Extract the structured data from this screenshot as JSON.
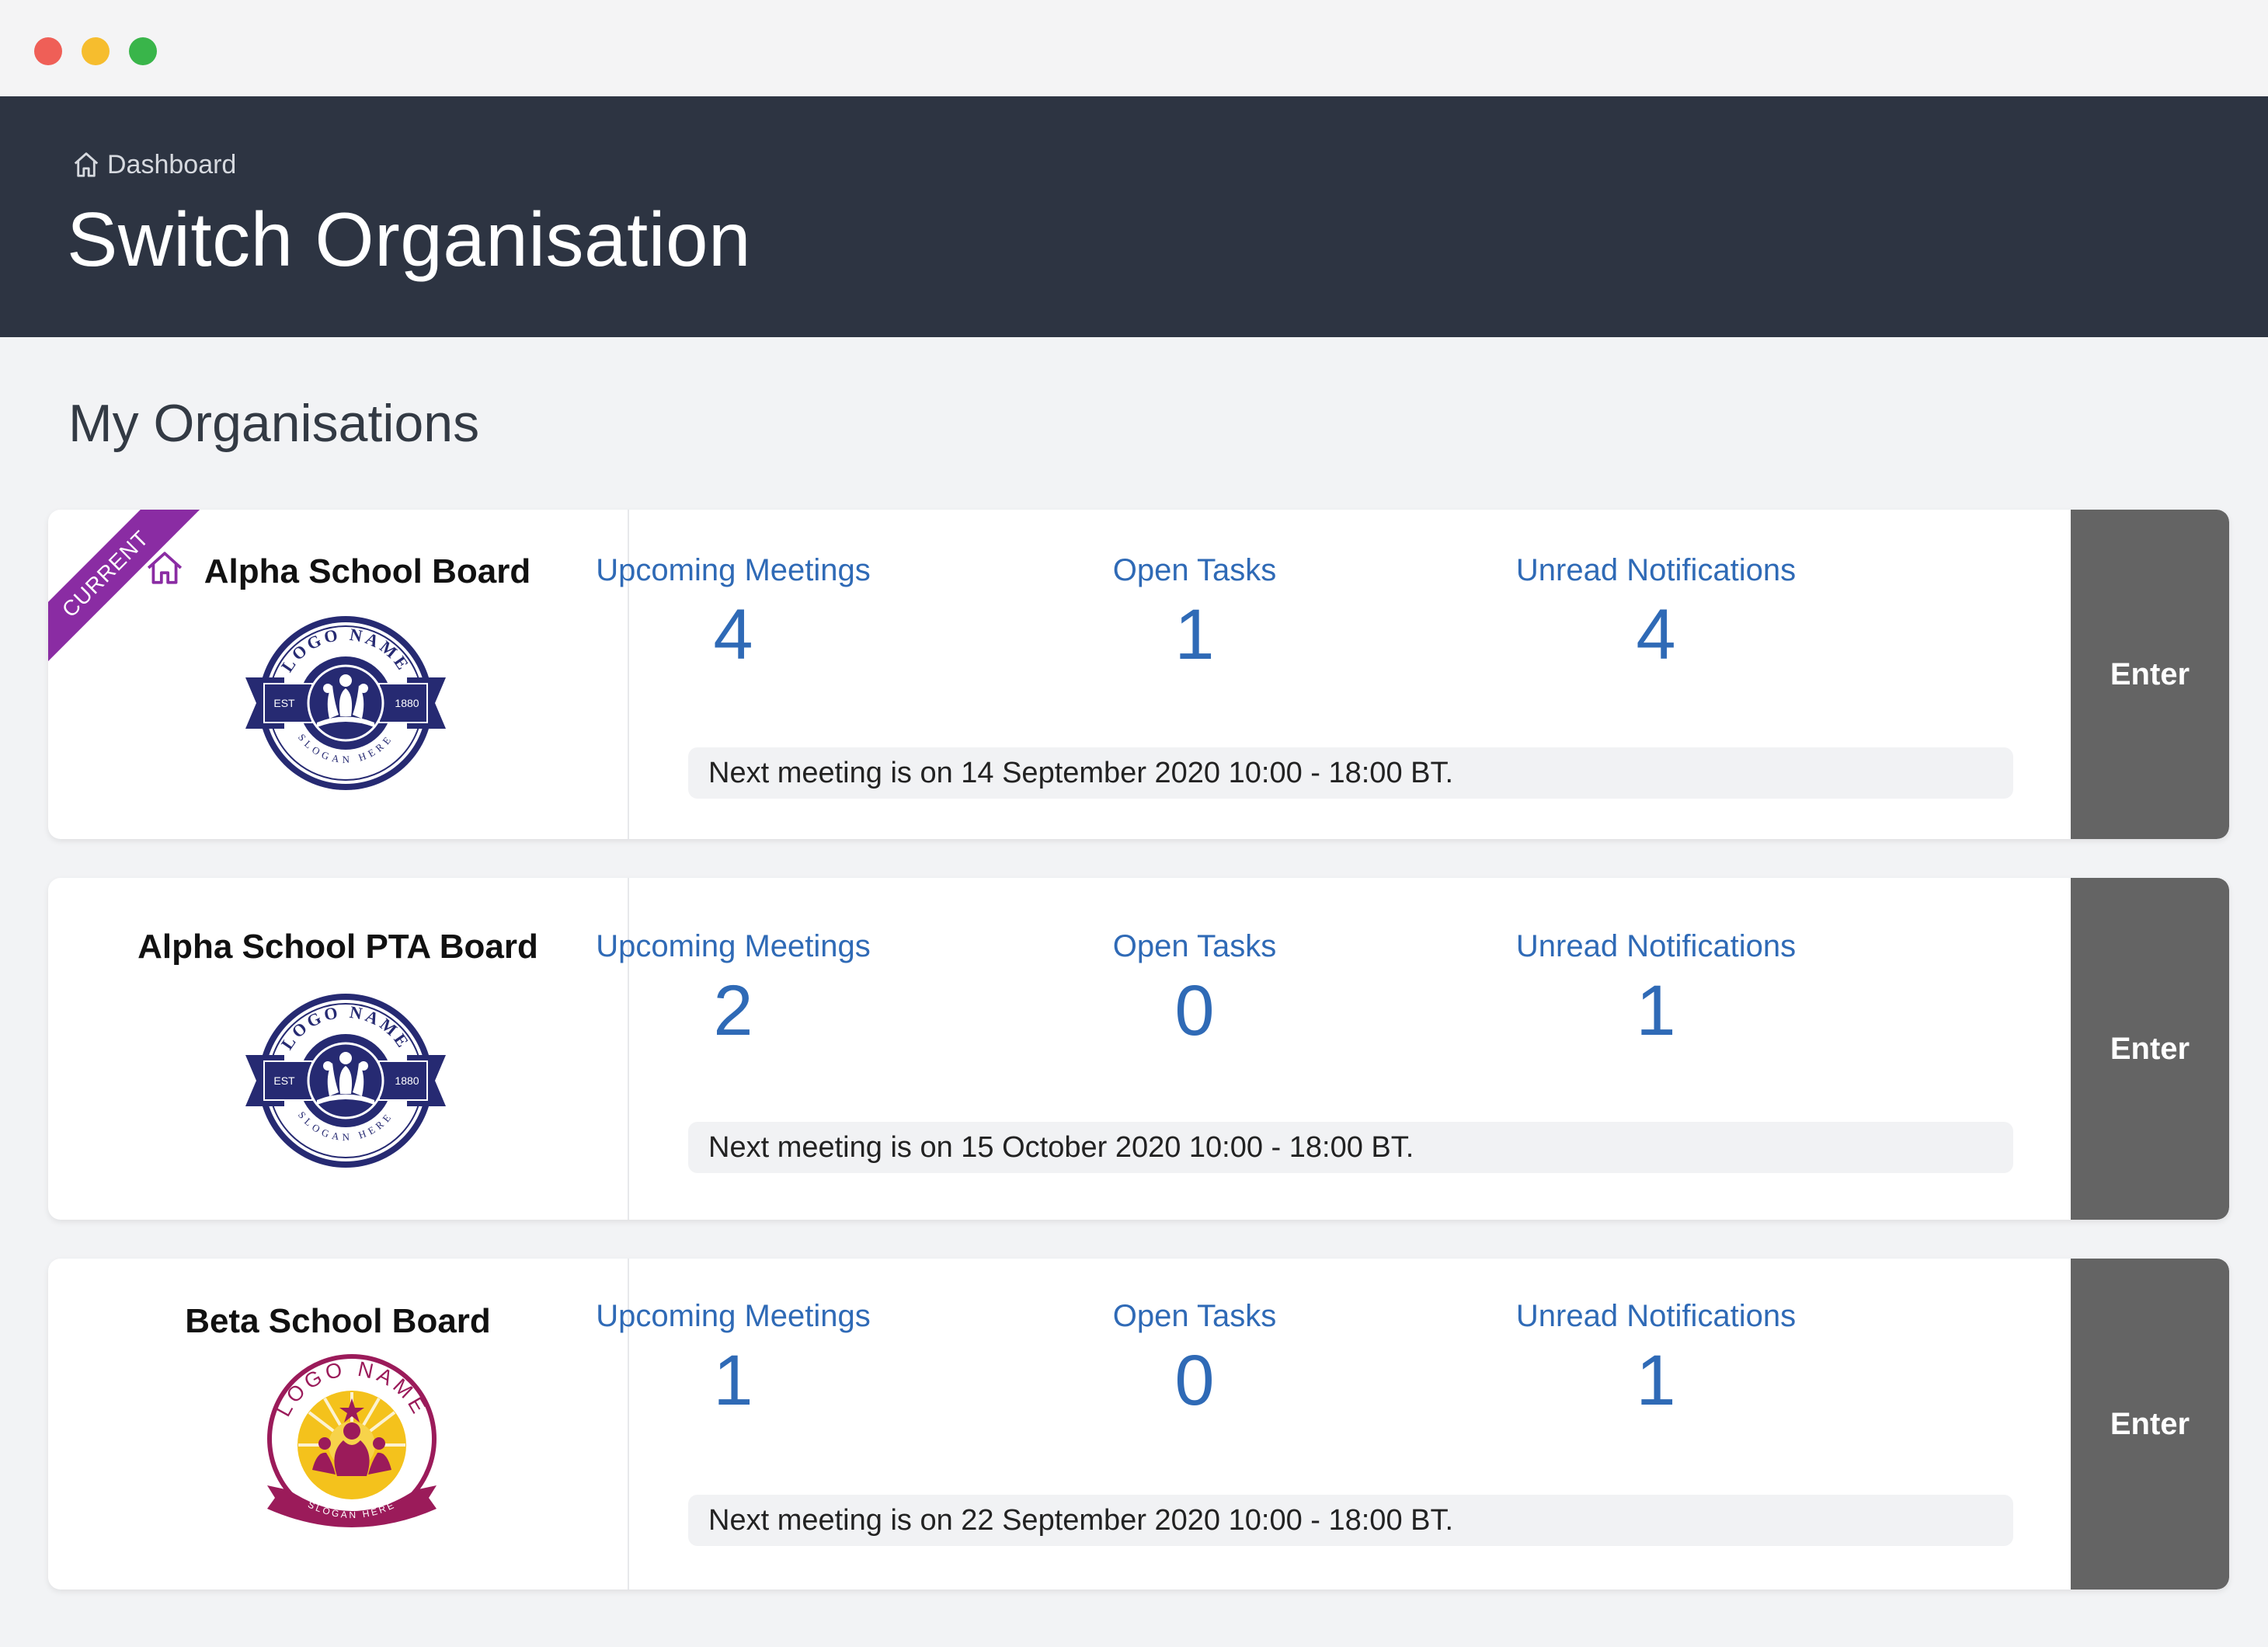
{
  "window": {
    "controls": [
      "close",
      "minimize",
      "maximize"
    ]
  },
  "header": {
    "breadcrumb": "Dashboard",
    "title": "Switch Organisation",
    "background": "#2d3442"
  },
  "section": {
    "title": "My Organisations"
  },
  "labels": {
    "upcoming_meetings": "Upcoming Meetings",
    "open_tasks": "Open Tasks",
    "unread_notifications": "Unread Notifications",
    "enter": "Enter"
  },
  "organisations": [
    {
      "name": "Alpha School Board",
      "current": true,
      "current_badge": "CURRENT",
      "upcoming_meetings": "4",
      "open_tasks": "1",
      "unread_notifications": "4",
      "next_meeting": "Next meeting is on 14 September 2020 10:00 - 18:00 BT.",
      "logo": {
        "style": "navy-badge",
        "top_text": "LOGO NAME",
        "bottom_text": "SLOGAN HERE",
        "left_text": "EST",
        "right_text": "1880"
      }
    },
    {
      "name": "Alpha School PTA Board",
      "current": false,
      "upcoming_meetings": "2",
      "open_tasks": "0",
      "unread_notifications": "1",
      "next_meeting": "Next meeting is on 15 October 2020 10:00 - 18:00 BT.",
      "logo": {
        "style": "navy-badge",
        "top_text": "LOGO NAME",
        "bottom_text": "SLOGAN HERE",
        "left_text": "EST",
        "right_text": "1880"
      }
    },
    {
      "name": "Beta School Board",
      "current": false,
      "upcoming_meetings": "1",
      "open_tasks": "0",
      "unread_notifications": "1",
      "next_meeting": "Next meeting is on 22 September 2020 10:00 - 18:00 BT.",
      "logo": {
        "style": "sunburst-badge",
        "top_text": "LOGO NAME",
        "bottom_text": "SLOGAN HERE"
      }
    }
  ],
  "colors": {
    "accent": "#2f6ab6",
    "current_ribbon": "#8a2ca3",
    "enter_button": "#646464",
    "navy_logo": "#262a72",
    "magenta_logo": "#9b1b5a",
    "gold_logo": "#f4c21c"
  }
}
